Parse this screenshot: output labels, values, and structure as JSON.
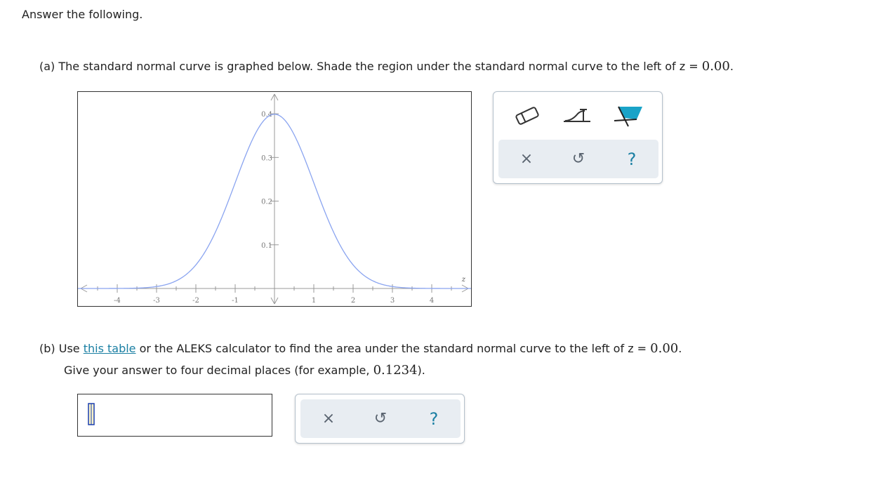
{
  "intro": "Answer the following.",
  "part_a": {
    "text": "(a) The standard normal curve is graphed below. Shade the region under the standard normal curve to the left of z = ",
    "z_value": "0.00",
    "end": "."
  },
  "graph": {
    "x_ticks": [
      "-4",
      "-3",
      "-2",
      "-1",
      "1",
      "2",
      "3",
      "4"
    ],
    "y_ticks": [
      "0.1",
      "0.2",
      "0.3",
      "0.4"
    ],
    "x_axis_label": "z",
    "curve": {
      "function": "standard normal density",
      "x_range": [
        -5,
        5
      ],
      "y_range": [
        0,
        0.45
      ]
    },
    "colors": {
      "curve": "#8aa4f0",
      "axis": "#999999"
    }
  },
  "tools": {
    "eraser_icon": "eraser-icon",
    "region_tool_icon": "curve-region-icon",
    "shade_tool_icon": "shade-flag-icon",
    "accent_color": "#1aa3c8"
  },
  "actions": {
    "clear": "×",
    "undo": "↺",
    "help": "?"
  },
  "part_b": {
    "prefix": "(b) Use ",
    "link": "this table",
    "middle": " or the ALEKS calculator to find the area under the standard normal curve to the left of z = ",
    "z_value": "0.00",
    "end": ".",
    "line2_prefix": "Give your answer to four decimal places (for example, ",
    "example": "0.1234",
    "line2_end": ")."
  },
  "answer": {
    "value": ""
  }
}
